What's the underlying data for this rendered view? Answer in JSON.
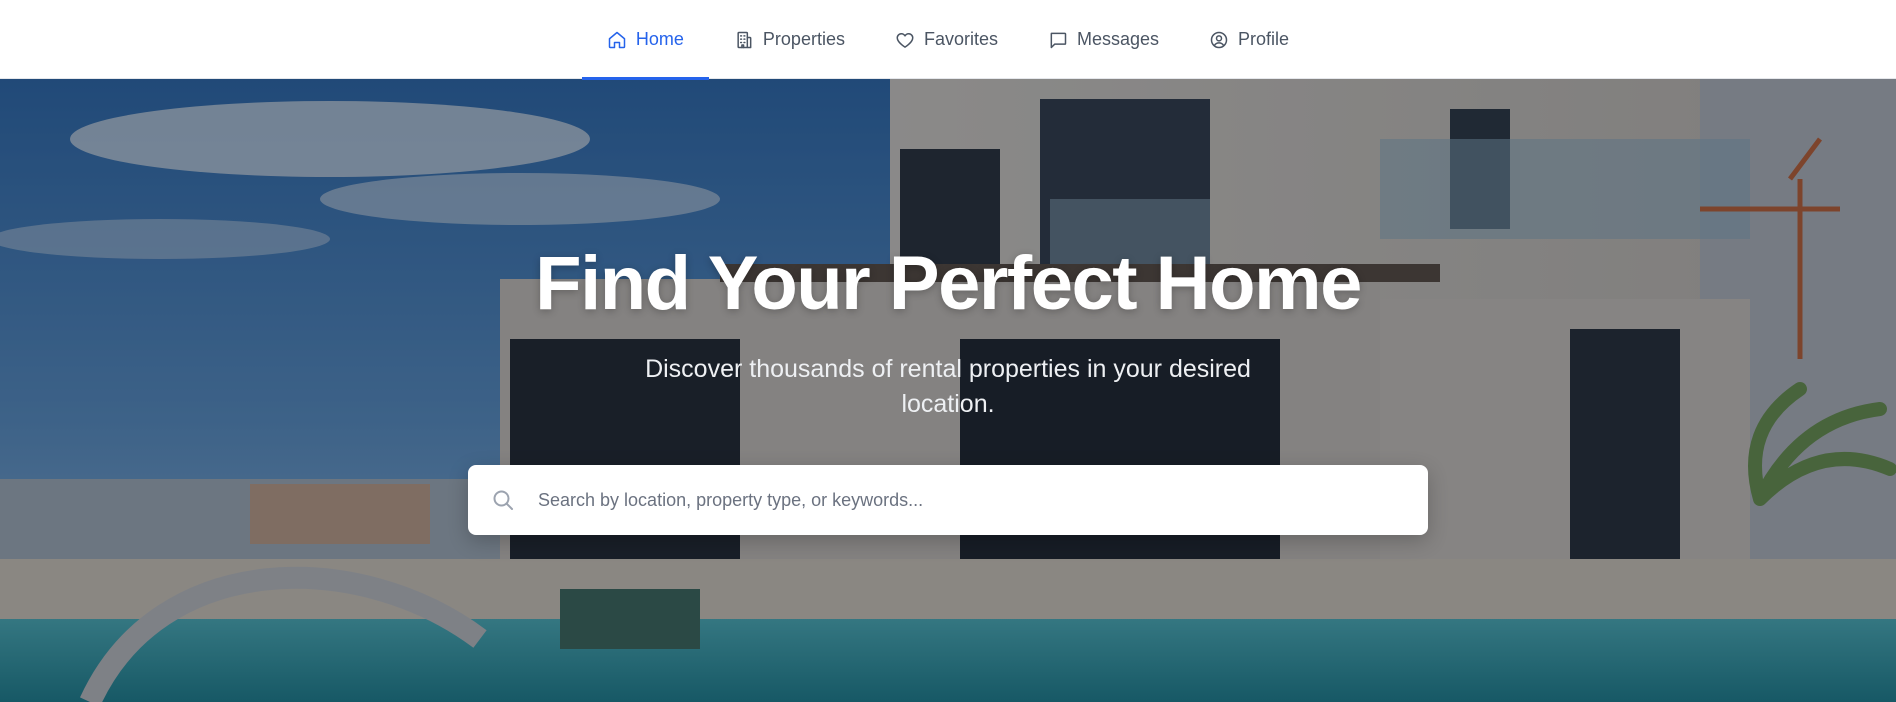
{
  "nav": {
    "items": [
      {
        "label": "Home",
        "icon": "home-icon",
        "active": true
      },
      {
        "label": "Properties",
        "icon": "building-icon",
        "active": false
      },
      {
        "label": "Favorites",
        "icon": "heart-icon",
        "active": false
      },
      {
        "label": "Messages",
        "icon": "message-icon",
        "active": false
      },
      {
        "label": "Profile",
        "icon": "user-circle-icon",
        "active": false
      }
    ],
    "active_color": "#2563eb",
    "inactive_color": "#4b5563"
  },
  "hero": {
    "title": "Find Your Perfect Home",
    "subtitle": "Discover thousands of rental properties in your desired location.",
    "background_image": "modern-villa-with-pool-photo"
  },
  "search": {
    "placeholder": "Search by location, property type, or keywords...",
    "value": "",
    "icon": "search-icon"
  }
}
